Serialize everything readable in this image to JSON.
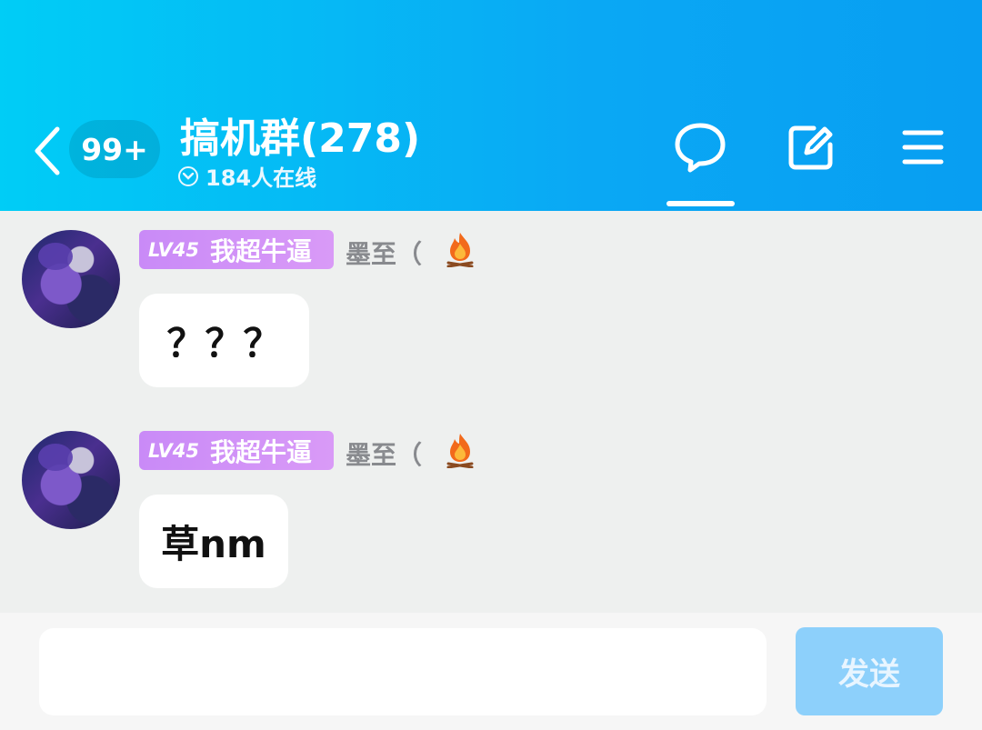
{
  "header": {
    "unread_badge": "99+",
    "group_title": "搞机群(278)",
    "online_text": "184人在线"
  },
  "messages": [
    {
      "level": "LV45",
      "member_title": "我超牛逼",
      "nickname": "墨至（",
      "text": "？？？"
    },
    {
      "level": "LV45",
      "member_title": "我超牛逼",
      "nickname": "墨至（",
      "text": "草nm"
    }
  ],
  "input": {
    "value": "",
    "send_label": "发送"
  },
  "colors": {
    "header_start": "#00cdf6",
    "header_end": "#089ef2",
    "level_badge": "#c98af7",
    "send_button": "#8dd0fb",
    "background": "#eef0ef"
  },
  "icons": [
    "back-chevron-icon",
    "chevron-down-circle-icon",
    "chat-bubble-icon",
    "edit-icon",
    "menu-icon",
    "fire-icon"
  ]
}
